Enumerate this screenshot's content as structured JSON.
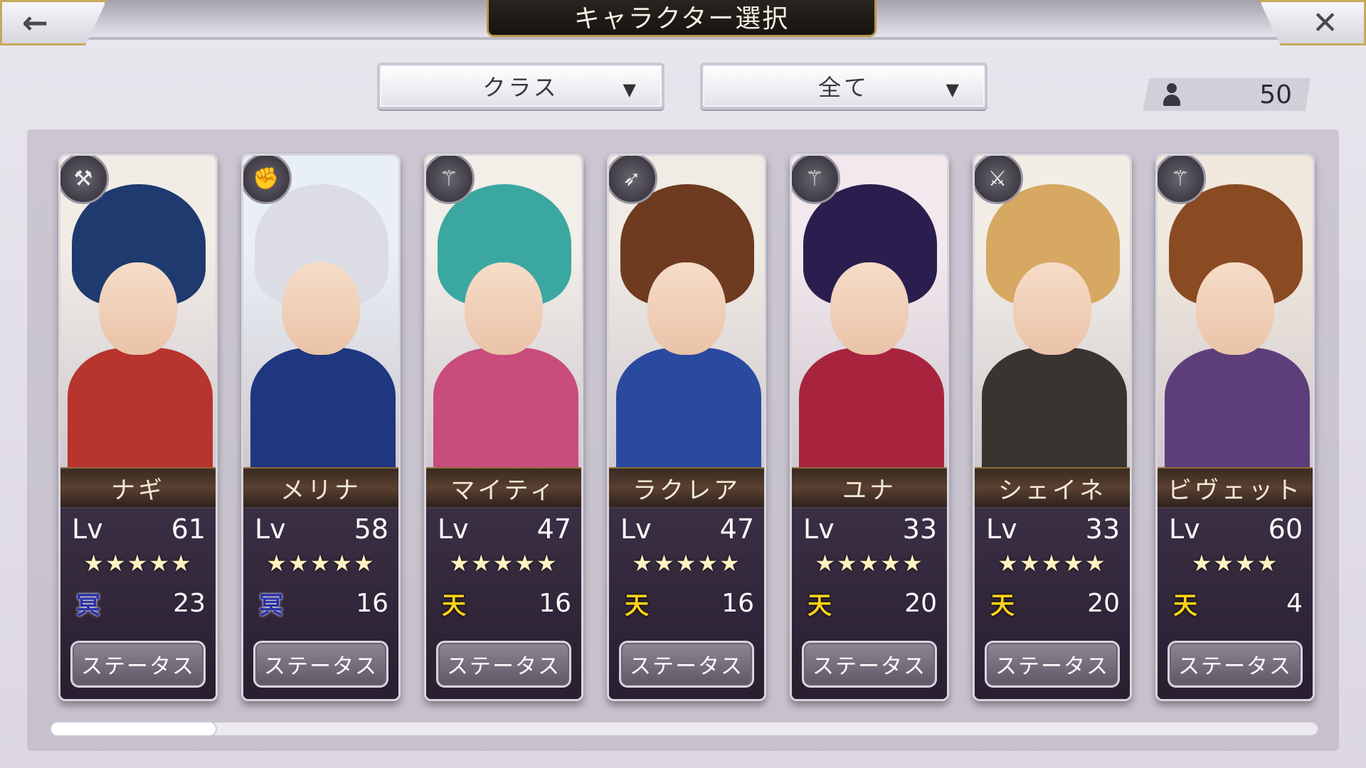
{
  "header": {
    "title": "キャラクター選択",
    "back_icon": "←",
    "close_icon": "✕"
  },
  "filters": {
    "class_label": "クラス",
    "scope_label": "全て",
    "dropdown_arrow": "▼"
  },
  "roster_count": "50",
  "status_button_label": "ステータス",
  "level_label": "Lv",
  "scroll_position_fraction": 0.13,
  "characters": [
    {
      "name": "ナギ",
      "level": "61",
      "stars": "★★★★★",
      "attr_icon": "冥",
      "attr_type": "dark",
      "value": "23",
      "class_icon": "axe-icon",
      "class_glyph": "⚒",
      "colors": {
        "hair": "#1e3a6e",
        "body": "#b8342e",
        "bg": "#f1ece6"
      }
    },
    {
      "name": "メリナ",
      "level": "58",
      "stars": "★★★★★",
      "attr_icon": "冥",
      "attr_type": "dark",
      "value": "16",
      "class_icon": "fist-icon",
      "class_glyph": "✊",
      "colors": {
        "hair": "#dcdce4",
        "body": "#1f3780",
        "bg": "#e8f0f6"
      }
    },
    {
      "name": "マイティ",
      "level": "47",
      "stars": "★★★★★",
      "attr_icon": "天",
      "attr_type": "heaven",
      "value": "16",
      "class_icon": "staff-icon",
      "class_glyph": "⚚",
      "colors": {
        "hair": "#3aa8a0",
        "body": "#c84c7c",
        "bg": "#f2eee8"
      }
    },
    {
      "name": "ラクレア",
      "level": "47",
      "stars": "★★★★★",
      "attr_icon": "天",
      "attr_type": "heaven",
      "value": "16",
      "class_icon": "bow-icon",
      "class_glyph": "➶",
      "colors": {
        "hair": "#6e3a20",
        "body": "#2a4aa0",
        "bg": "#f0ebe4"
      }
    },
    {
      "name": "ユナ",
      "level": "33",
      "stars": "★★★★★",
      "attr_icon": "天",
      "attr_type": "heaven",
      "value": "20",
      "class_icon": "staff-icon",
      "class_glyph": "⚚",
      "colors": {
        "hair": "#2a1e4e",
        "body": "#a8243e",
        "bg": "#f3e8ee"
      }
    },
    {
      "name": "シェイネ",
      "level": "33",
      "stars": "★★★★★",
      "attr_icon": "天",
      "attr_type": "heaven",
      "value": "20",
      "class_icon": "sword-icon",
      "class_glyph": "⚔",
      "colors": {
        "hair": "#d6a862",
        "body": "#3a3430",
        "bg": "#f2eee6"
      }
    },
    {
      "name": "ビヴェット",
      "level": "60",
      "stars": "★★★★",
      "attr_icon": "天",
      "attr_type": "heaven",
      "value": "4",
      "class_icon": "staff-icon",
      "class_glyph": "⚚",
      "colors": {
        "hair": "#8a4a22",
        "body": "#5e3e7a",
        "bg": "#f0e8dc"
      }
    }
  ]
}
